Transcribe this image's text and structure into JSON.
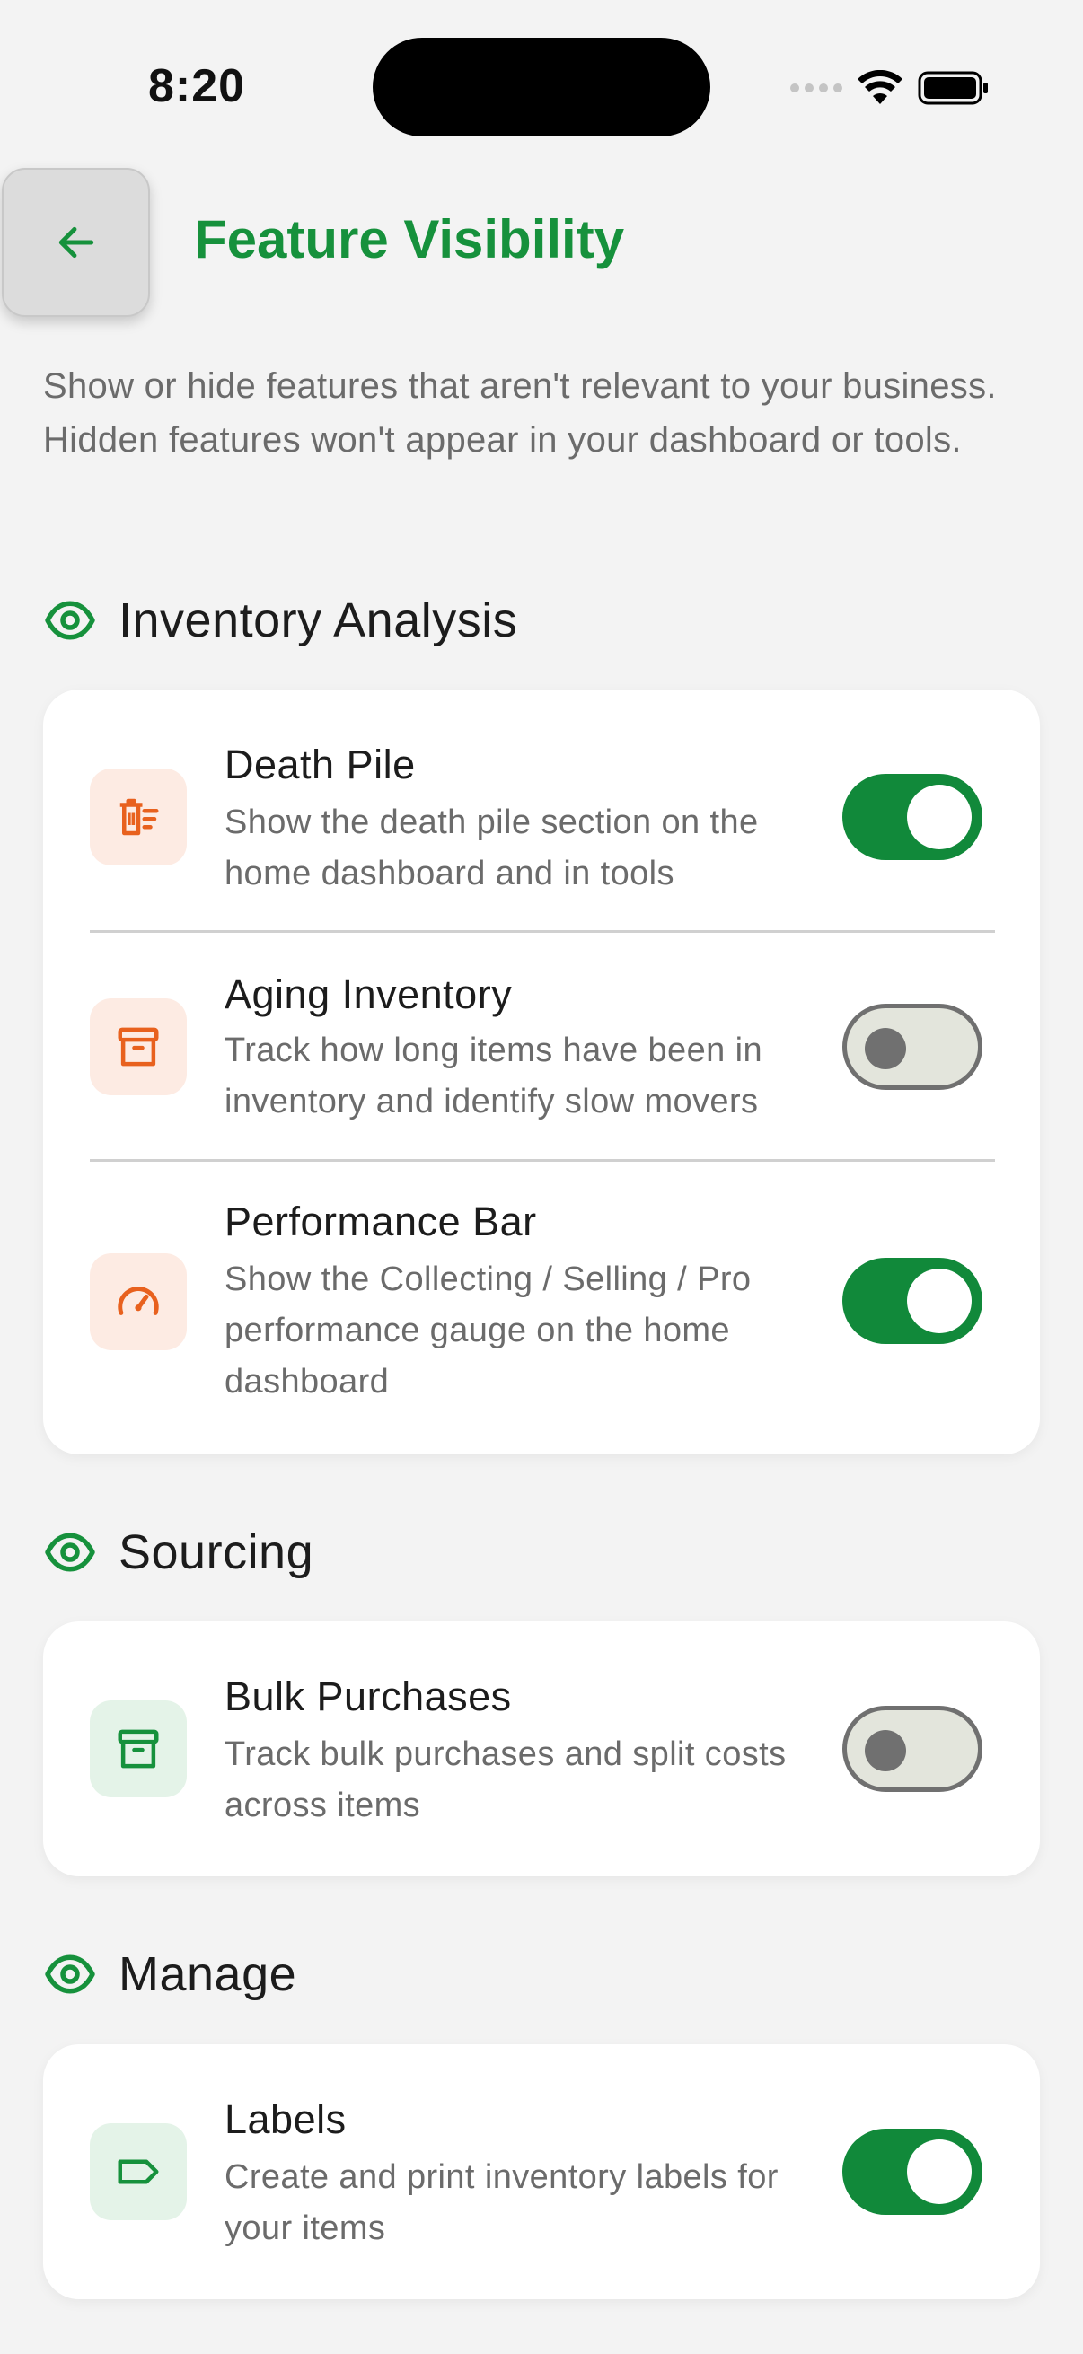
{
  "status_bar": {
    "time": "8:20"
  },
  "header": {
    "title": "Feature Visibility"
  },
  "intro": "Show or hide features that aren't relevant to your business. Hidden features won't appear in your dashboard or tools.",
  "colors": {
    "accent": "#16913c",
    "toggle_on": "#11893a",
    "icon_orange": "#e8611e",
    "icon_green": "#16913c"
  },
  "sections": [
    {
      "title": "Inventory Analysis",
      "icon": "eye-icon",
      "items": [
        {
          "title": "Death Pile",
          "desc": "Show the death pile section on the home dashboard and in tools",
          "icon": "trash-list-icon",
          "enabled": true
        },
        {
          "title": "Aging Inventory",
          "desc": "Track how long items have been in inventory and identify slow movers",
          "icon": "archive-box-icon",
          "enabled": false
        },
        {
          "title": "Performance Bar",
          "desc": "Show the Collecting / Selling / Pro performance gauge on the home dashboard",
          "icon": "gauge-icon",
          "enabled": true
        }
      ]
    },
    {
      "title": "Sourcing",
      "icon": "eye-icon",
      "items": [
        {
          "title": "Bulk Purchases",
          "desc": "Track bulk purchases and split costs across items",
          "icon": "archive-box-icon",
          "enabled": false
        }
      ]
    },
    {
      "title": "Manage",
      "icon": "eye-icon",
      "items": [
        {
          "title": "Labels",
          "desc": "Create and print inventory labels for your items",
          "icon": "tag-icon",
          "enabled": true
        }
      ]
    }
  ]
}
